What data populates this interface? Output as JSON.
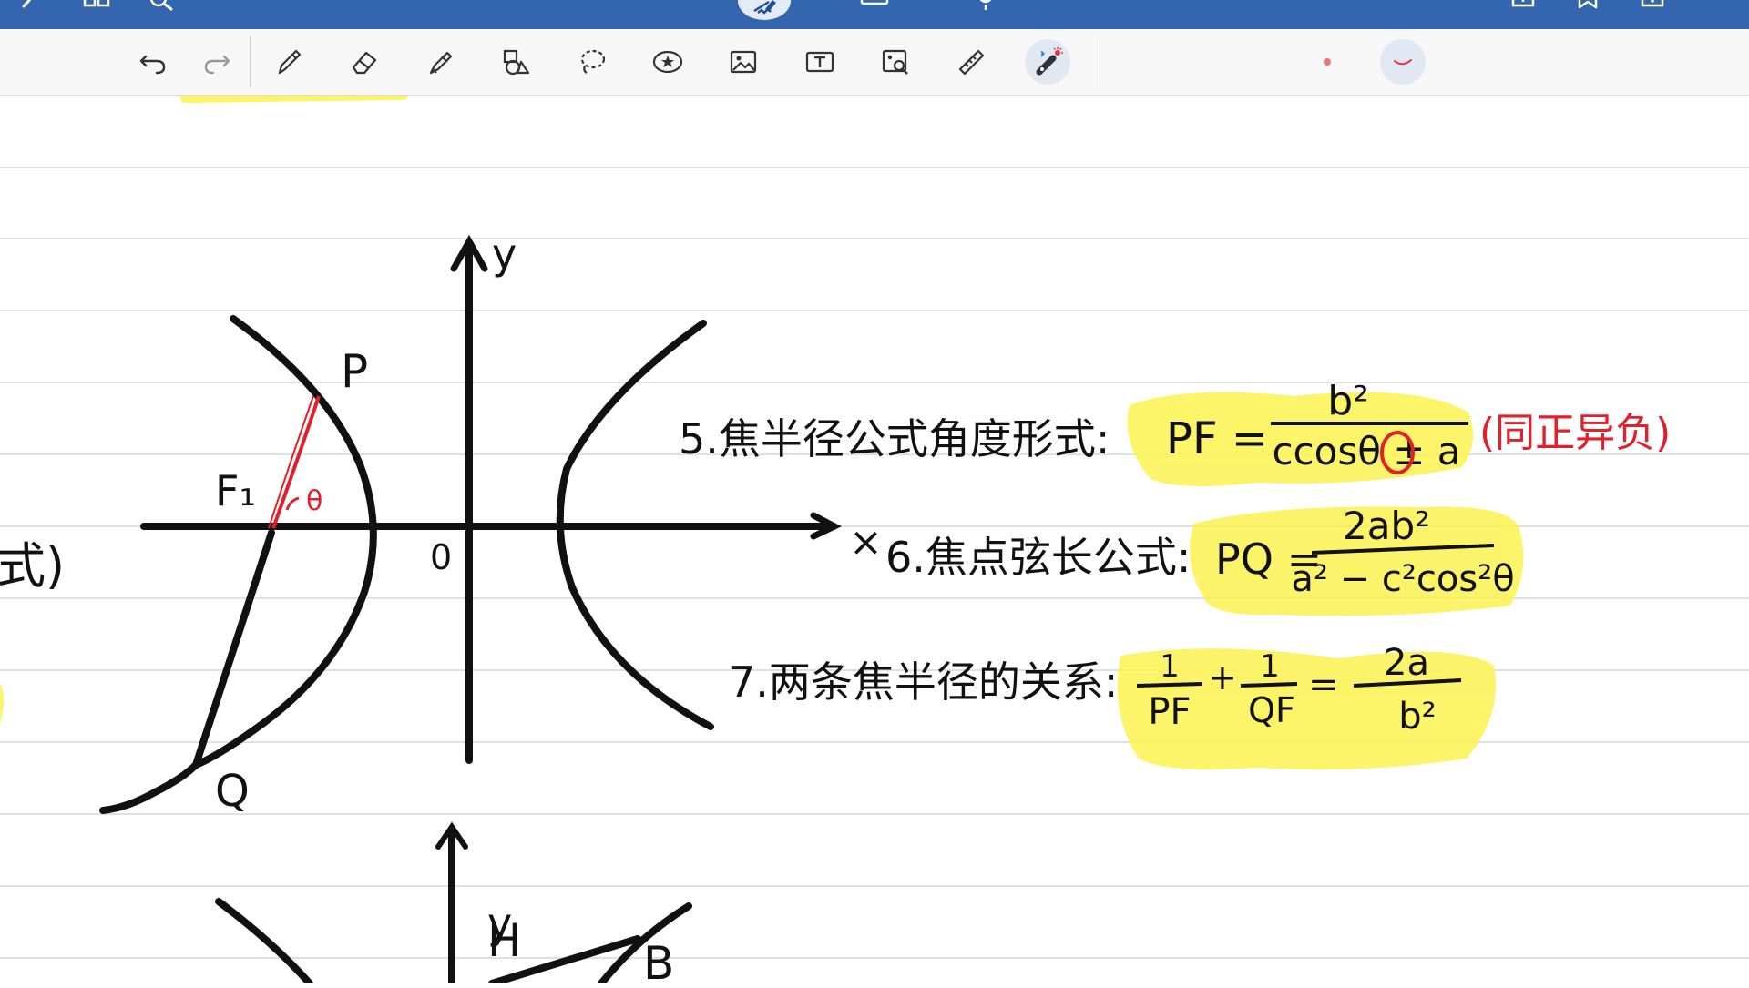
{
  "app": {
    "accent": "#3466b0",
    "toolbar_bg": "#f7f7f8"
  },
  "topbar": {
    "icons": [
      "back-icon",
      "grid-icon",
      "search-icon",
      "pen-mode-icon",
      "keyboard-icon",
      "microphone-icon",
      "add-page-icon",
      "bookmark-icon",
      "more-icon"
    ]
  },
  "toolbar": {
    "tools": [
      "undo",
      "redo",
      "pen",
      "eraser",
      "highlighter",
      "shapes",
      "lasso",
      "sticker",
      "image",
      "text",
      "scan-image",
      "ruler",
      "laser-pointer"
    ],
    "selected_tool": "laser-pointer",
    "colors": {
      "dot": "#f0484e",
      "laser": "#e6323b"
    }
  },
  "note": {
    "ink_color": "#111111",
    "red_ink": "#e2202b",
    "highlight": "#fbf24f",
    "diagram1": {
      "y_label": "y",
      "origin": "0",
      "P": "P",
      "F1": "F₁",
      "theta": "θ",
      "Q": "Q"
    },
    "left_fragment": "式)",
    "formula5": {
      "label": "5.焦半径公式角度形式:",
      "lhs": "PF =",
      "num": "b²",
      "den": "ccosθ ± a",
      "note": "(同正异负)"
    },
    "formula6": {
      "prefix": "×",
      "label": "6.焦点弦长公式:",
      "lhs": "PQ =",
      "num": "2ab²",
      "den": "a² − c²cos²θ"
    },
    "formula7": {
      "label": "7.两条焦半径的关系:",
      "t1_num": "1",
      "t1_den": "PF",
      "plus": "+",
      "t2_num": "1",
      "t2_den": "QF",
      "eq": "=",
      "rhs_num": "2a",
      "rhs_den": "b²"
    },
    "diagram2": {
      "y_label": "y",
      "H": "H",
      "B": "B"
    }
  }
}
